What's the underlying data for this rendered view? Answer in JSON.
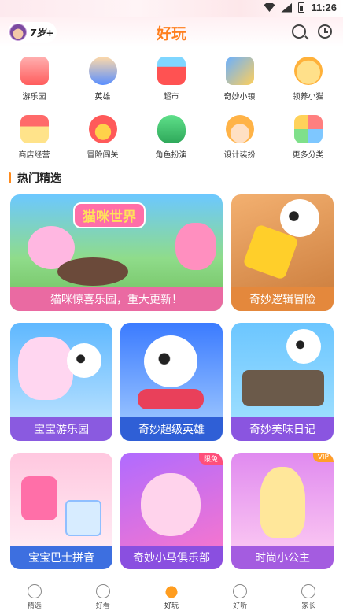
{
  "status_bar": {
    "time": "11:26"
  },
  "header": {
    "age": "7岁+",
    "title": "好玩"
  },
  "categories": [
    {
      "label": "游乐园",
      "icon": "carousel-icon",
      "color": "#ff6f6f"
    },
    {
      "label": "英雄",
      "icon": "hero-icon",
      "color": "#5aa0ff"
    },
    {
      "label": "超市",
      "icon": "basket-icon",
      "color": "#ff5a5a"
    },
    {
      "label": "奇妙小镇",
      "icon": "town-icon",
      "color": "#6ab0ff"
    },
    {
      "label": "领养小猫",
      "icon": "cat-icon",
      "color": "#ffc23a"
    },
    {
      "label": "商店经营",
      "icon": "shop-icon",
      "color": "#ff7f7f"
    },
    {
      "label": "冒险闯关",
      "icon": "adventure-icon",
      "color": "#ff6060"
    },
    {
      "label": "角色扮演",
      "icon": "dinosaur-icon",
      "color": "#3fc86a"
    },
    {
      "label": "设计装扮",
      "icon": "princess-icon",
      "color": "#ffb347"
    },
    {
      "label": "更多分类",
      "icon": "more-apps-icon",
      "color": "#7ec7ff"
    }
  ],
  "section": {
    "title": "热门精选"
  },
  "cards": [
    {
      "title": "猫咪惊喜乐园，重大更新！",
      "banner": "猫咪世界",
      "badge": ""
    },
    {
      "title": "奇妙逻辑冒险",
      "badge": ""
    },
    {
      "title": "宝宝游乐园",
      "badge": ""
    },
    {
      "title": "奇妙超级英雄",
      "badge": ""
    },
    {
      "title": "奇妙美味日记",
      "badge": ""
    },
    {
      "title": "宝宝巴士拼音",
      "badge": ""
    },
    {
      "title": "奇妙小马俱乐部",
      "badge": "限免"
    },
    {
      "title": "时尚小公主",
      "badge": "VIP"
    }
  ],
  "tabbar": [
    {
      "label": "精选",
      "icon": "star-tab-icon",
      "active": false
    },
    {
      "label": "好看",
      "icon": "play-tab-icon",
      "active": false
    },
    {
      "label": "好玩",
      "icon": "duck-tab-icon",
      "active": true
    },
    {
      "label": "好听",
      "icon": "headphone-tab-icon",
      "active": false
    },
    {
      "label": "家长",
      "icon": "parent-tab-icon",
      "active": false
    }
  ],
  "colors": {
    "accent": "#ff7f1e",
    "caption_pink": "#e96aa0",
    "caption_orange": "#e58a3a",
    "caption_blue": "#3d6fe0",
    "caption_purple": "#8a55e0"
  }
}
